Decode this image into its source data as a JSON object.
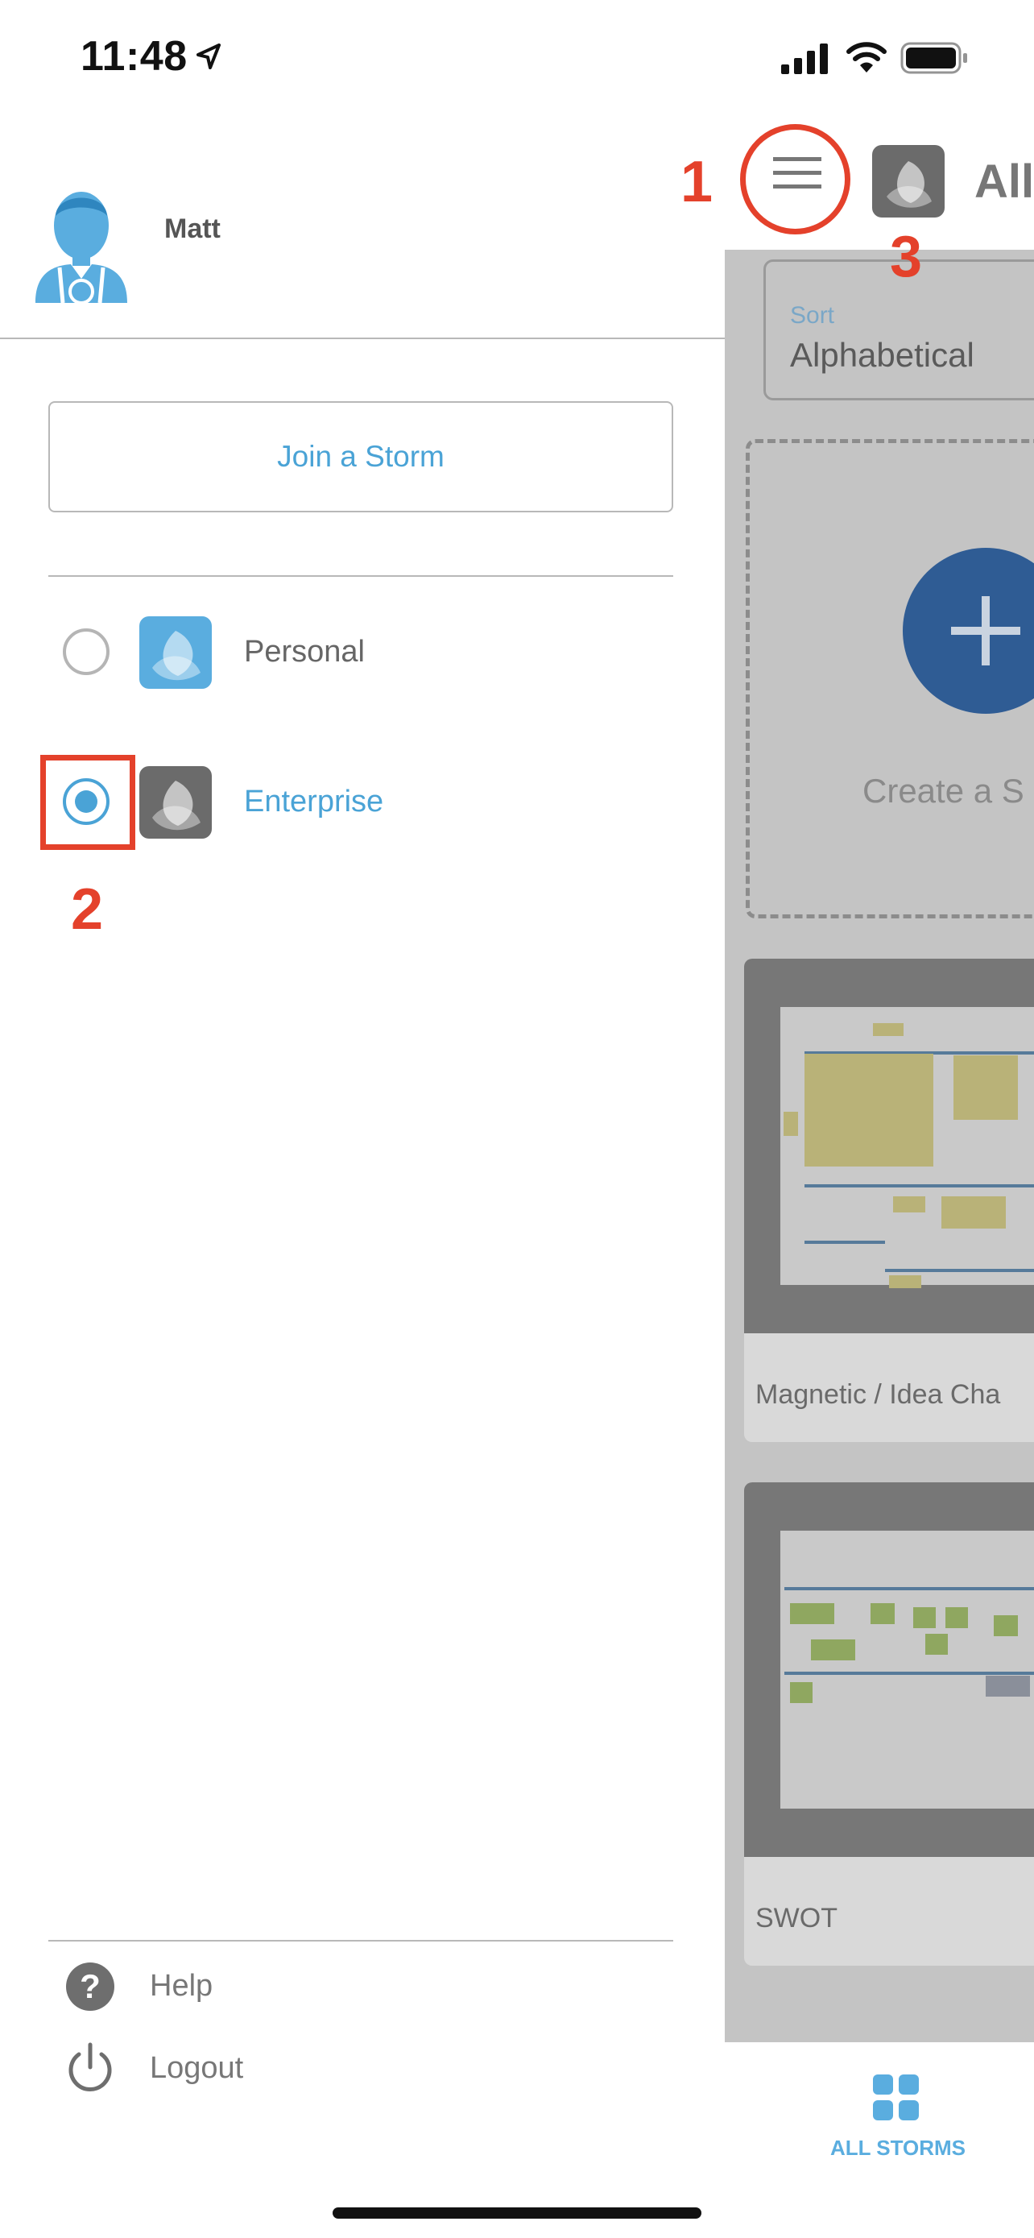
{
  "status_bar": {
    "time": "11:48"
  },
  "drawer": {
    "user_name": "Matt",
    "join_button": "Join a Storm",
    "workspaces": [
      {
        "label": "Personal",
        "selected": false,
        "icon": "storm-logo-icon",
        "icon_color": "#5aaddf"
      },
      {
        "label": "Enterprise",
        "selected": true,
        "icon": "storm-logo-icon",
        "icon_color": "#6b6b6b"
      }
    ],
    "footer": [
      {
        "label": "Help",
        "icon": "help-icon"
      },
      {
        "label": "Logout",
        "icon": "power-icon"
      }
    ]
  },
  "main": {
    "title": "All",
    "sort": {
      "label": "Sort",
      "value": "Alphabetical"
    },
    "create_label": "Create a S",
    "cards": [
      {
        "title": "Magnetic / Idea Cha"
      },
      {
        "title": "SWOT"
      }
    ],
    "tab": "ALL STORMS"
  },
  "annotations": [
    "1",
    "2",
    "3"
  ],
  "colors": {
    "accent": "#4aa3d6",
    "annotation": "#e4412b",
    "personal_icon": "#5aaddf",
    "enterprise_icon": "#6b6b6b"
  }
}
